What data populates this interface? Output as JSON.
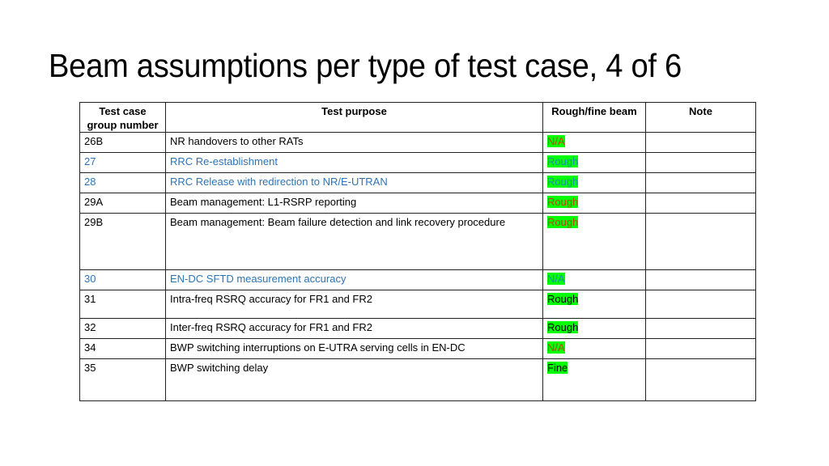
{
  "slide": {
    "title": "Beam assumptions per type of test case, 4 of 6"
  },
  "table": {
    "headers": {
      "group": "Test case group number",
      "purpose": "Test purpose",
      "beam": "Rough/fine beam",
      "note": "Note"
    },
    "rows": [
      {
        "group": "26B",
        "purpose": "NR handovers to other RATs",
        "beam": "N/A",
        "note": "",
        "text_color": "black",
        "beam_color": "red"
      },
      {
        "group": "27",
        "purpose": "RRC Re-establishment",
        "beam": "Rough",
        "note": "",
        "text_color": "blue",
        "beam_color": "blue"
      },
      {
        "group": "28",
        "purpose": "RRC Release with redirection to NR/E-UTRAN",
        "beam": "Rough",
        "note": "",
        "text_color": "blue",
        "beam_color": "blue"
      },
      {
        "group": "29A",
        "purpose": "Beam management: L1-RSRP reporting",
        "beam": "Rough",
        "note": "",
        "text_color": "black",
        "beam_color": "red"
      },
      {
        "group": "29B",
        "purpose": "Beam management: Beam failure detection and link recovery procedure",
        "beam": "Rough",
        "note": "",
        "text_color": "black",
        "beam_color": "red"
      },
      {
        "group": "30",
        "purpose": "EN-DC SFTD measurement accuracy",
        "beam": "N/A",
        "note": "",
        "text_color": "blue",
        "beam_color": "blue"
      },
      {
        "group": "31",
        "purpose": "Intra-freq RSRQ accuracy for FR1 and FR2",
        "beam": "Rough",
        "note": "",
        "text_color": "black",
        "beam_color": "black"
      },
      {
        "group": "32",
        "purpose": "Inter-freq RSRQ accuracy for FR1 and FR2",
        "beam": "Rough",
        "note": "",
        "text_color": "black",
        "beam_color": "black"
      },
      {
        "group": "34",
        "purpose": "BWP switching interruptions on E-UTRA serving cells in EN-DC",
        "beam": "N/A",
        "note": "",
        "text_color": "black",
        "beam_color": "red"
      },
      {
        "group": "35",
        "purpose": "BWP switching delay",
        "beam": "Fine",
        "note": "",
        "text_color": "black",
        "beam_color": "black"
      }
    ],
    "colors": {
      "highlight": "#00ff00",
      "blue_text": "#2e74b5",
      "red_text": "#b5470f"
    }
  }
}
